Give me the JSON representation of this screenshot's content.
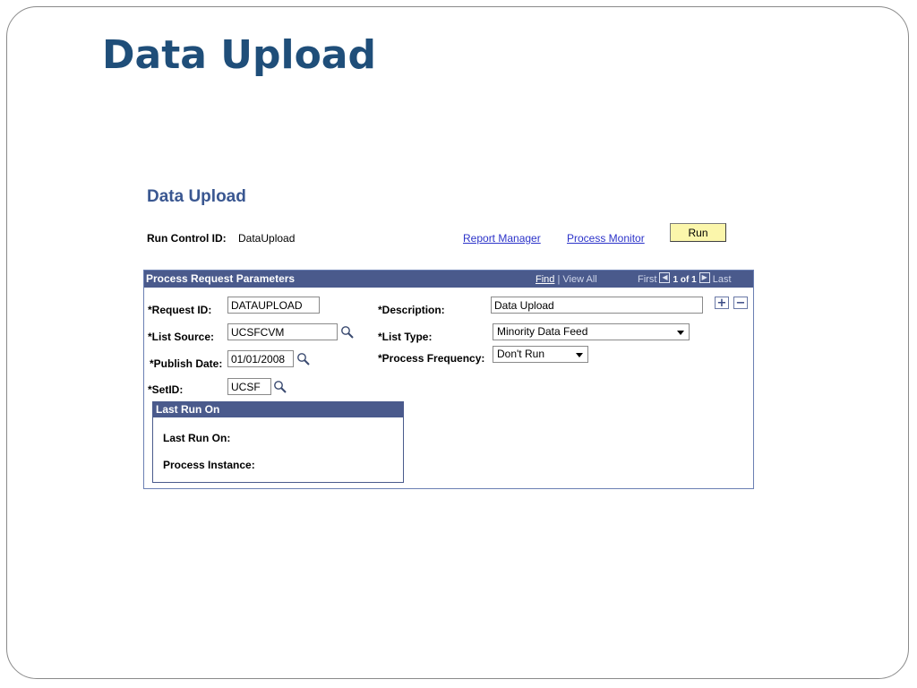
{
  "slide": {
    "title": "Data Upload"
  },
  "page": {
    "heading": "Data Upload",
    "run_control_label": "Run Control ID:",
    "run_control_value": "DataUpload",
    "report_manager_link": "Report Manager",
    "process_monitor_link": "Process Monitor",
    "run_button_label": "Run"
  },
  "panel": {
    "title": "Process Request Parameters",
    "nav": {
      "find": "Find",
      "separator": "|",
      "view_all": "View All",
      "first": "First",
      "count": "1 of 1",
      "last": "Last"
    },
    "add_row_symbol": "+",
    "delete_row_symbol": "−"
  },
  "fields": {
    "request_id": {
      "label": "*Request ID:",
      "value": "DATAUPLOAD"
    },
    "description": {
      "label": "*Description:",
      "value": "Data Upload"
    },
    "list_source": {
      "label": "*List Source:",
      "value": "UCSFCVM"
    },
    "list_type": {
      "label": "*List Type:",
      "value": "Minority Data Feed"
    },
    "publish_date": {
      "label": "*Publish Date:",
      "value": "01/01/2008"
    },
    "process_frequency": {
      "label": "*Process Frequency:",
      "value": "Don't Run"
    },
    "setid": {
      "label": "*SetID:",
      "value": "UCSF"
    }
  },
  "last_run": {
    "title": "Last Run On",
    "last_run_on_label": "Last Run On:",
    "process_instance_label": "Process Instance:"
  },
  "colors": {
    "slide_title": "#1f4e79",
    "header_bar": "#4a5a8c",
    "link": "#2c33c9",
    "run_button": "#fbf6ab"
  },
  "icons": {
    "lookup": "magnifier-icon",
    "prev": "arrow-left-icon",
    "next": "arrow-right-icon"
  }
}
